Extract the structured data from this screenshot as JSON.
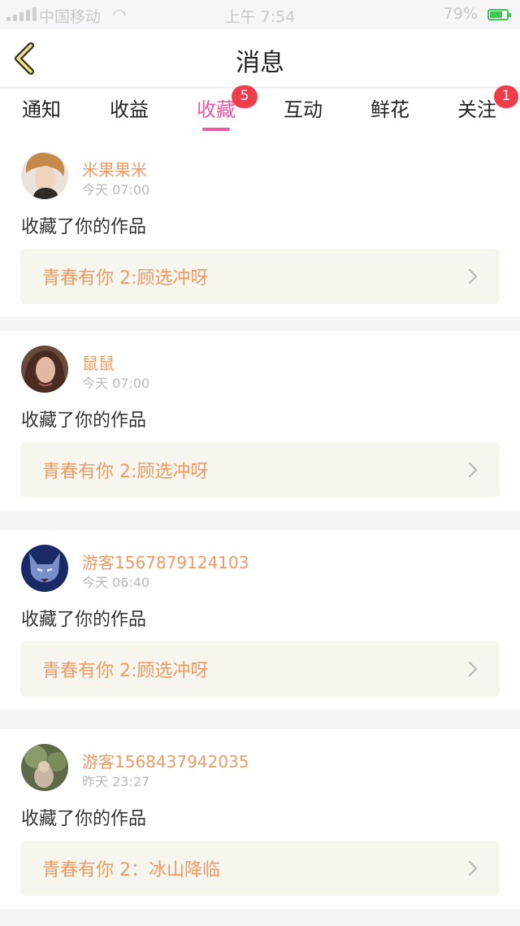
{
  "status_bar": {
    "carrier": "中国移动",
    "time": "上午 7:54",
    "battery": "79%"
  },
  "header": {
    "title": "消息",
    "back_icon": "chevron-left-icon"
  },
  "tabs": [
    {
      "label": "通知",
      "badge": null,
      "active": false
    },
    {
      "label": "收益",
      "badge": null,
      "active": false
    },
    {
      "label": "收藏",
      "badge": "5",
      "active": true
    },
    {
      "label": "互动",
      "badge": null,
      "active": false
    },
    {
      "label": "鲜花",
      "badge": null,
      "active": false
    },
    {
      "label": "关注",
      "badge": "1",
      "active": false
    }
  ],
  "colors": {
    "accent": "#ec5aa0",
    "username": "#ef9a64",
    "badge": "#f03c4b",
    "work_card_bg": "#f6f6ee"
  },
  "messages": [
    {
      "username": "米果果米",
      "time": "今天 07:00",
      "action": "收藏了你的作品",
      "work": "青春有你 2:顾选冲呀"
    },
    {
      "username": "鼠鼠",
      "time": "今天 07:00",
      "action": "收藏了你的作品",
      "work": "青春有你 2:顾选冲呀"
    },
    {
      "username": "游客1567879124103",
      "time": "今天 06:40",
      "action": "收藏了你的作品",
      "work": "青春有你 2:顾选冲呀"
    },
    {
      "username": "游客1568437942035",
      "time": "昨天 23:27",
      "action": "收藏了你的作品",
      "work": "青春有你 2：冰山降临"
    }
  ]
}
